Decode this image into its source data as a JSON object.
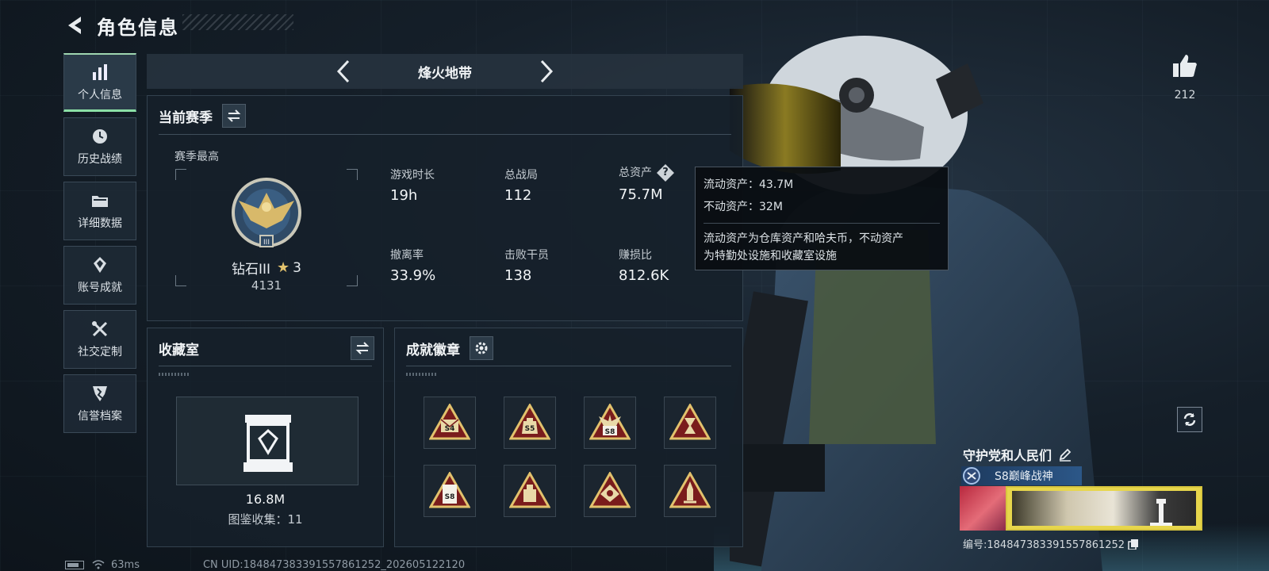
{
  "header": {
    "title": "角色信息"
  },
  "sidebar": {
    "items": [
      {
        "label": "个人信息",
        "icon": "bar-chart-icon",
        "active": true
      },
      {
        "label": "历史战绩",
        "icon": "clock-icon"
      },
      {
        "label": "详细数据",
        "icon": "folder-icon"
      },
      {
        "label": "账号成就",
        "icon": "achievement-icon"
      },
      {
        "label": "社交定制",
        "icon": "tools-icon"
      },
      {
        "label": "信誉档案",
        "icon": "shield-icon"
      }
    ]
  },
  "mode_bar": {
    "title": "烽火地带"
  },
  "season": {
    "title": "当前赛季",
    "subtitle": "赛季最高",
    "rank_name": "钻石III",
    "rank_stars": "3",
    "rank_score": "4131",
    "stats": [
      {
        "label": "游戏时长",
        "value": "19h"
      },
      {
        "label": "总战局",
        "value": "112"
      },
      {
        "label": "总资产",
        "value": "75.7M"
      },
      {
        "label": "撤离率",
        "value": "33.9%"
      },
      {
        "label": "击败干员",
        "value": "138"
      },
      {
        "label": "赚损比",
        "value": "812.6K"
      }
    ]
  },
  "tooltip": {
    "liquid": "流动资产：43.7M",
    "fixed": "不动资产：32M",
    "desc_line1": "流动资产为仓库资产和哈夫币，不动资产",
    "desc_line2": "为特勤处设施和收藏室设施"
  },
  "collection": {
    "title": "收藏室",
    "value": "16.8M",
    "count": "图鉴收集：11"
  },
  "achievements": {
    "title": "成就徽章",
    "badges": [
      {
        "icon": "s4-envelope-badge-icon",
        "text": "S4"
      },
      {
        "icon": "s5-bag-badge-icon",
        "text": "S5"
      },
      {
        "icon": "s8-wing-badge-icon",
        "text": "S8"
      },
      {
        "icon": "hourglass-badge-icon",
        "text": ""
      },
      {
        "icon": "s8-card-badge-icon",
        "text": "S8"
      },
      {
        "icon": "jar-badge-icon",
        "text": ""
      },
      {
        "icon": "crest-badge-icon",
        "text": ""
      },
      {
        "icon": "rocket-badge-icon",
        "text": ""
      }
    ]
  },
  "profile": {
    "likes": "212",
    "name": "守护党和人民们",
    "title_badge": "S8巅峰战神",
    "uid": "编号:1848473833915578612​52"
  },
  "status": {
    "ping": "63ms",
    "uid_line": "CN UID:1848473833915578612​52_202605122120"
  },
  "colors": {
    "accent_green": "#8be0a6",
    "gold": "#e2c26d",
    "badge_red": "#7a1c1c",
    "title_blue": "#2c5788"
  }
}
